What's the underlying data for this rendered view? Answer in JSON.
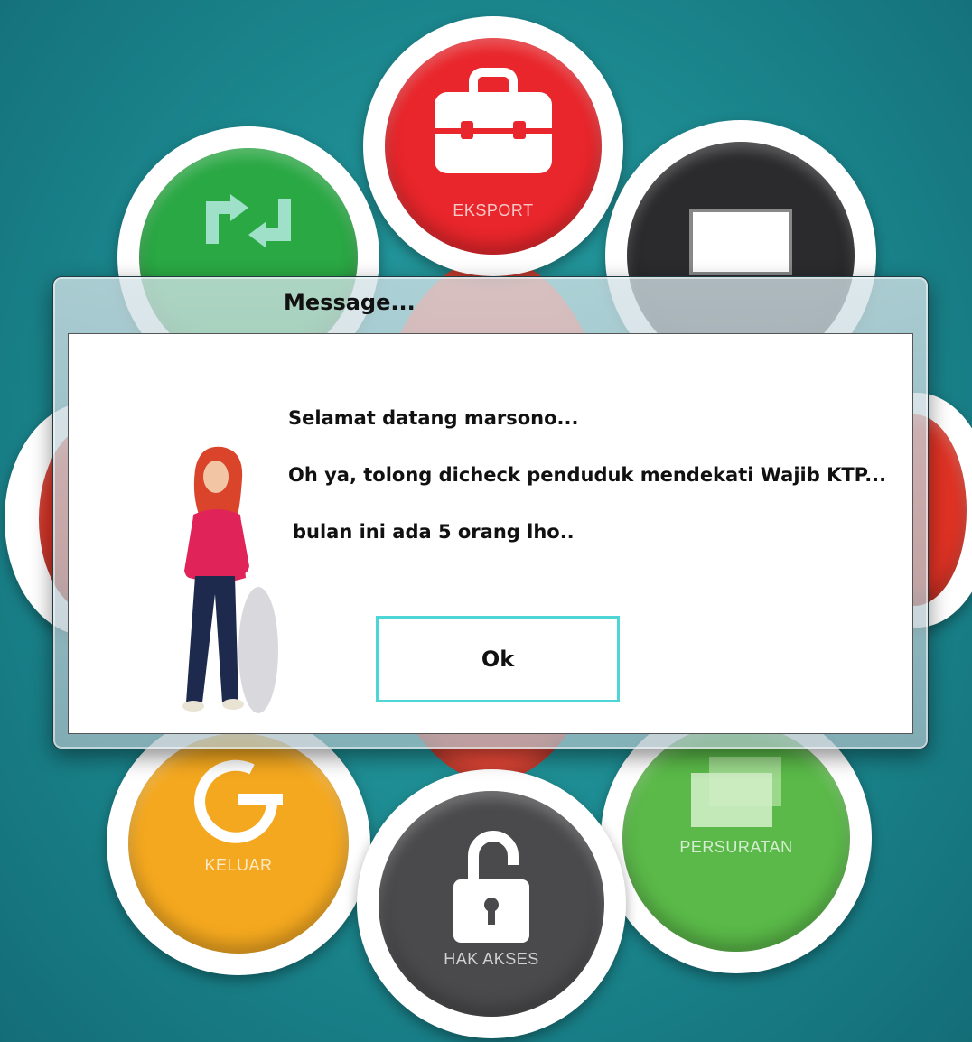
{
  "menu": {
    "eksport_label": "EKSPORT",
    "keluar_label": "KELUAR",
    "persuratan_label": "PERSURATAN",
    "hak_akses_label": "HAK AKSES"
  },
  "dialog": {
    "title": "Message...",
    "line1": "Selamat datang marsono...",
    "line2": "Oh ya, tolong dicheck penduduk mendekati Wajib KTP...",
    "line3": "bulan ini ada 5 orang lho..",
    "ok_label": "Ok"
  },
  "colors": {
    "background": "#1d8c92",
    "eksport": "#e8262b",
    "refresh": "#2aa844",
    "monitor": "#2b2b2d",
    "keluar": "#f4a81f",
    "persuratan": "#5ab948",
    "hak_akses": "#4a4a4c",
    "ok_border": "#4ed6d6"
  }
}
